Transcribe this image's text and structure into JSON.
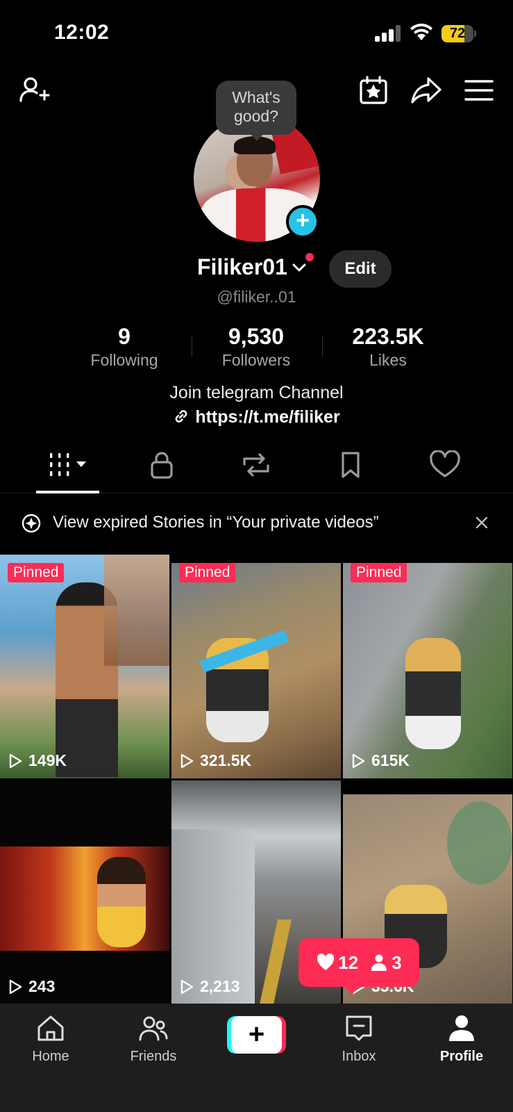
{
  "status_bar": {
    "time": "12:02",
    "battery_percent": "72",
    "battery_level": 0.72,
    "battery_color": "#f5cc14"
  },
  "top_icons": [
    "add-friend-icon",
    "calendar-star-icon",
    "share-icon",
    "menu-icon"
  ],
  "profile": {
    "note_bubble": "What's good?",
    "display_name": "Filiker01",
    "edit_label": "Edit",
    "username": "@filiker..01",
    "stats": [
      {
        "value": "9",
        "label": "Following"
      },
      {
        "value": "9,530",
        "label": "Followers"
      },
      {
        "value": "223.5K",
        "label": "Likes"
      }
    ],
    "bio_line": "Join telegram Channel",
    "bio_link": "https://t.me/filiker"
  },
  "tabs": [
    "videos-grid-icon",
    "lock-icon",
    "repost-icon",
    "bookmark-icon",
    "heart-icon"
  ],
  "stories_banner": {
    "text": "View expired Stories in “Your private videos”"
  },
  "videos": [
    {
      "pinned_label": "Pinned",
      "views": "149K"
    },
    {
      "pinned_label": "Pinned",
      "views": "321.5K"
    },
    {
      "pinned_label": "Pinned",
      "views": "615K"
    },
    {
      "pinned_label": "",
      "views": "243"
    },
    {
      "pinned_label": "",
      "views": "2,213"
    },
    {
      "pinned_label": "",
      "views": "35.6K"
    }
  ],
  "notification_pill": {
    "likes": "12",
    "followers": "3"
  },
  "bottom_nav": [
    {
      "label": "Home",
      "icon": "home-icon"
    },
    {
      "label": "Friends",
      "icon": "friends-icon"
    },
    {
      "label": "",
      "icon": "plus-icon"
    },
    {
      "label": "Inbox",
      "icon": "inbox-icon"
    },
    {
      "label": "Profile",
      "icon": "profile-icon"
    }
  ],
  "colors": {
    "accent": "#fe2c55",
    "cyan": "#25f4ee",
    "avatar_plus": "#27c2e6"
  }
}
